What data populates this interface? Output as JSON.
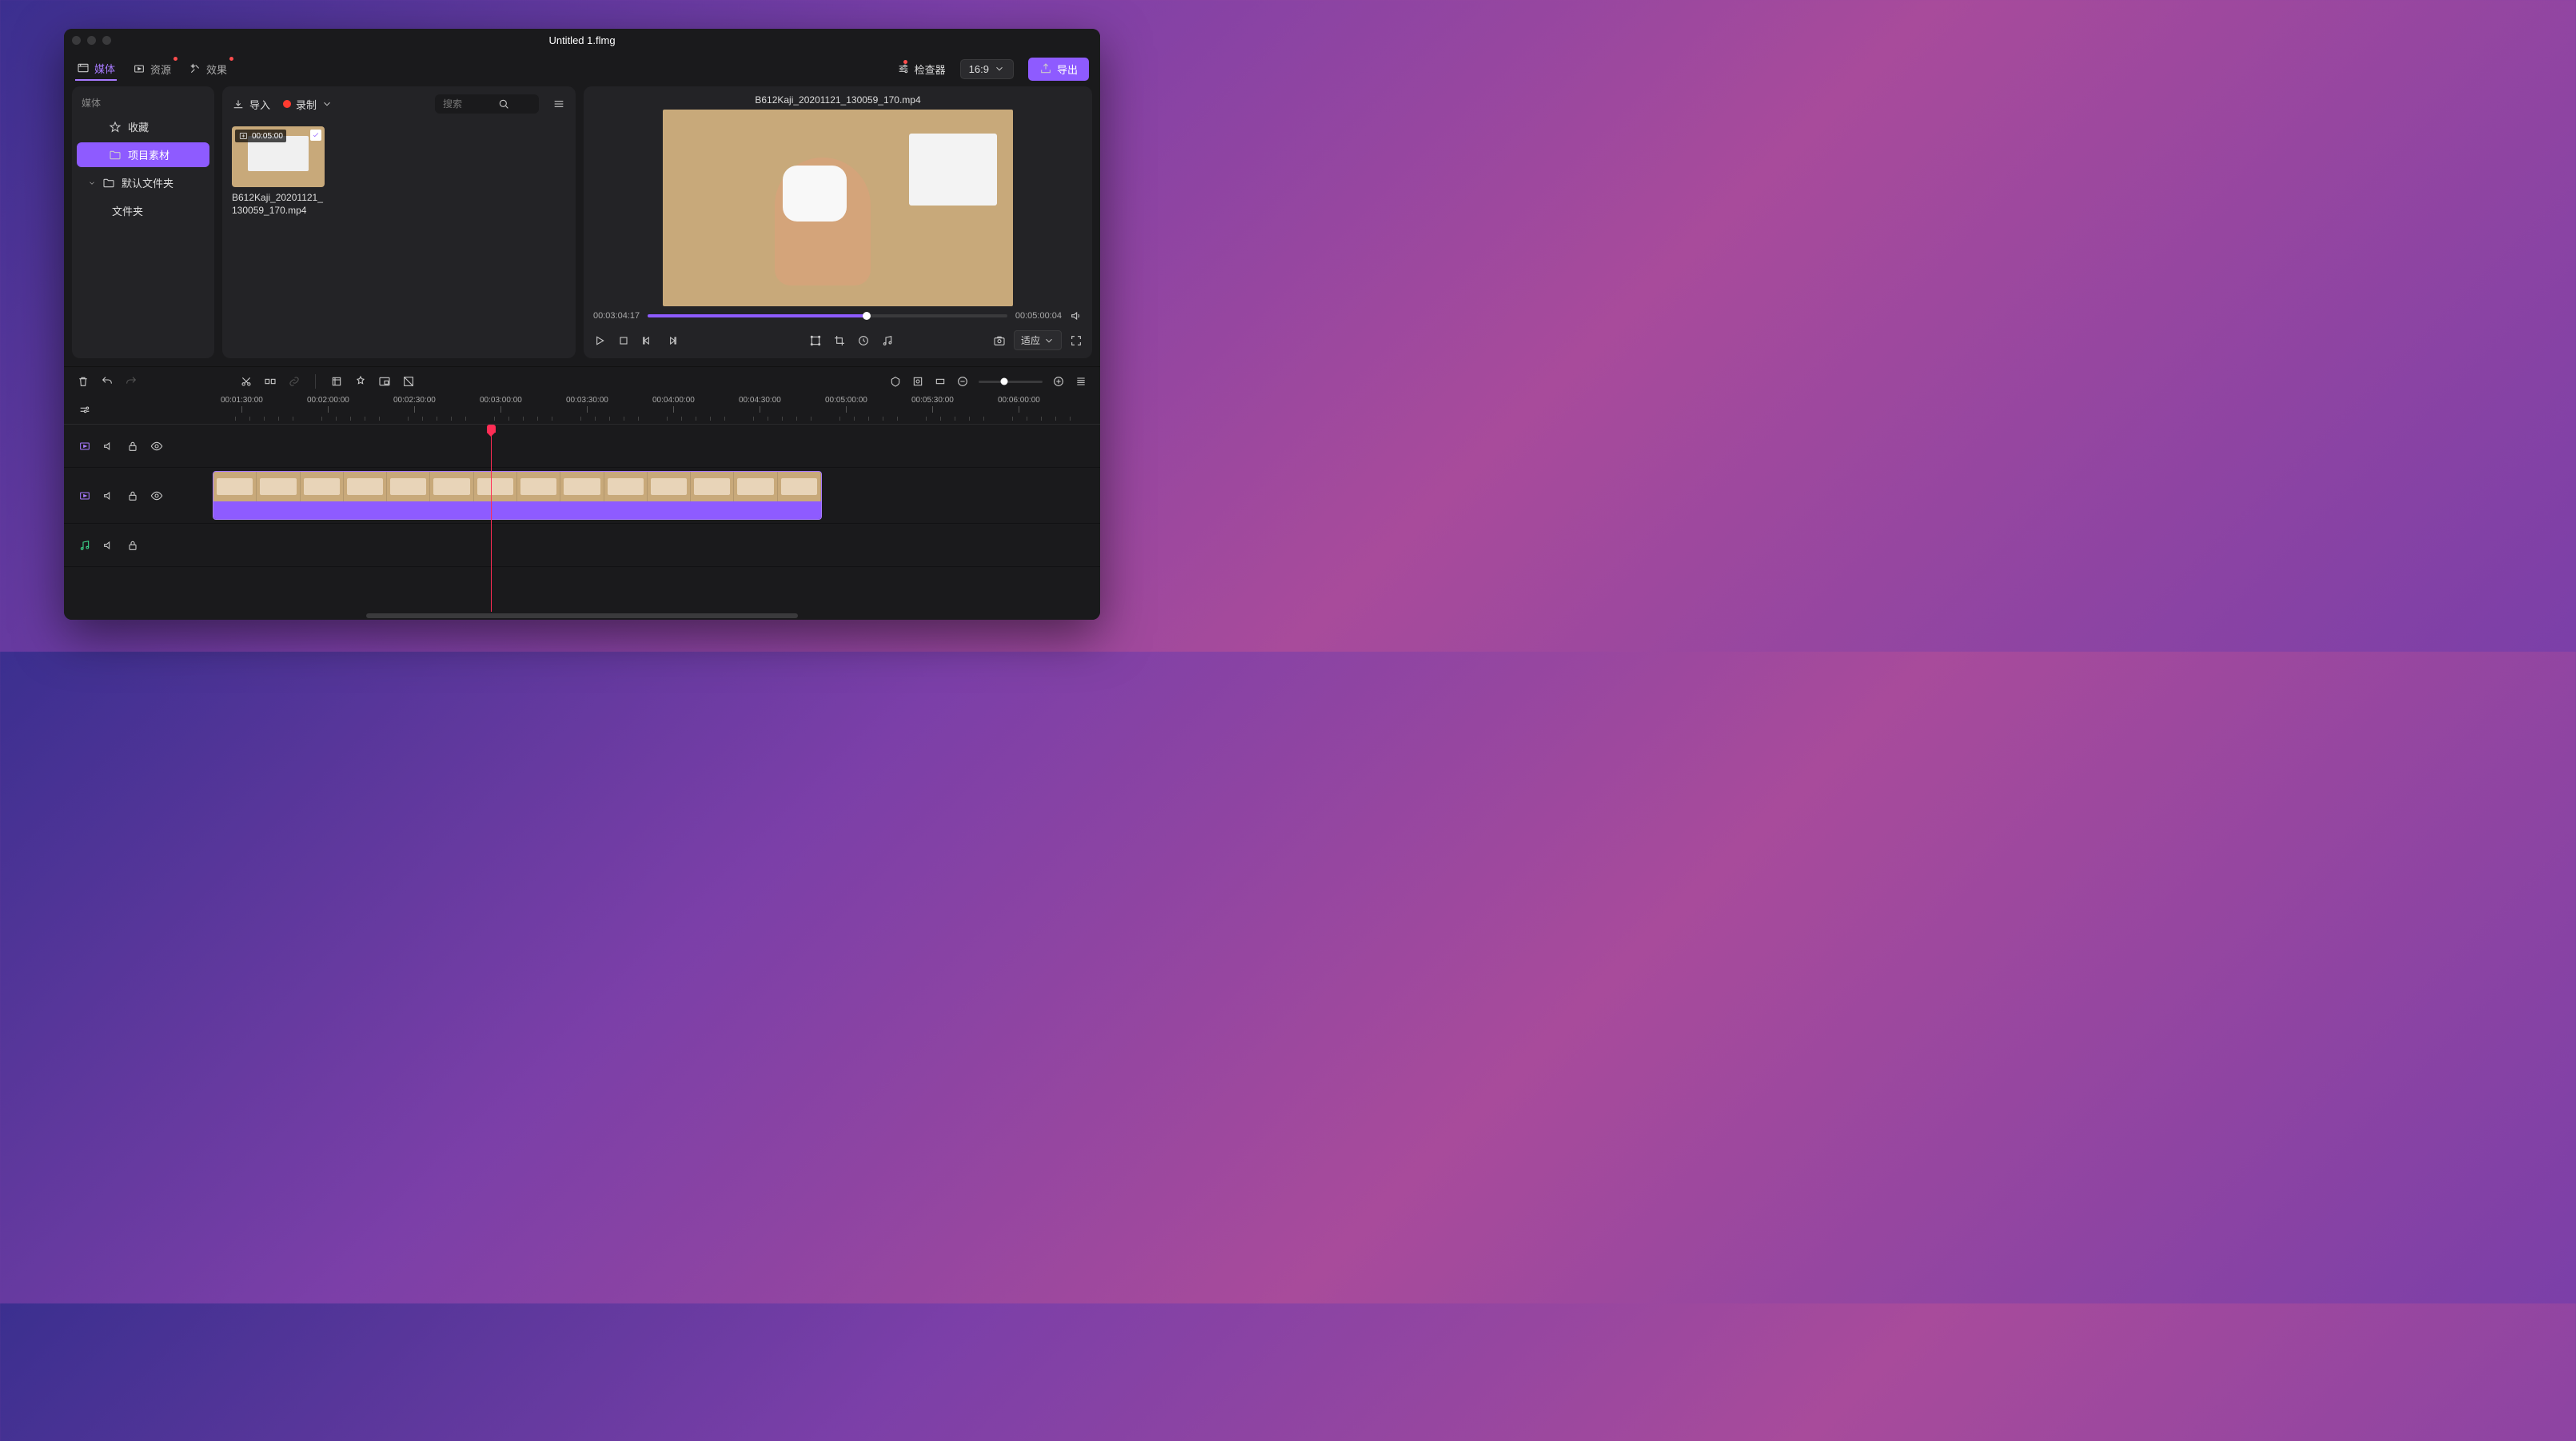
{
  "window": {
    "title": "Untitled 1.flmg"
  },
  "tabs": {
    "media": "媒体",
    "resources": "资源",
    "effects": "效果"
  },
  "inspector_label": "检查器",
  "ratio_label": "16:9",
  "export_label": "导出",
  "sidebar": {
    "header": "媒体",
    "favorites": "收藏",
    "project_media": "项目素材",
    "default_folder": "默认文件夹",
    "folder": "文件夹"
  },
  "mediabar": {
    "import": "导入",
    "record": "录制",
    "search_placeholder": "搜索"
  },
  "clip": {
    "duration": "00:05:00",
    "name": "B612Kaji_20201121_130059_170.mp4"
  },
  "preview": {
    "filename": "B612Kaji_20201121_130059_170.mp4",
    "current_time": "00:03:04:17",
    "total_time": "00:05:00:04",
    "fit_label": "适应"
  },
  "ruler": {
    "marks": [
      "00:01:30:00",
      "00:02:00:00",
      "00:02:30:00",
      "00:03:00:00",
      "00:03:30:00",
      "00:04:00:00",
      "00:04:30:00",
      "00:05:00:00",
      "00:05:30:00",
      "00:06:00:00"
    ]
  }
}
